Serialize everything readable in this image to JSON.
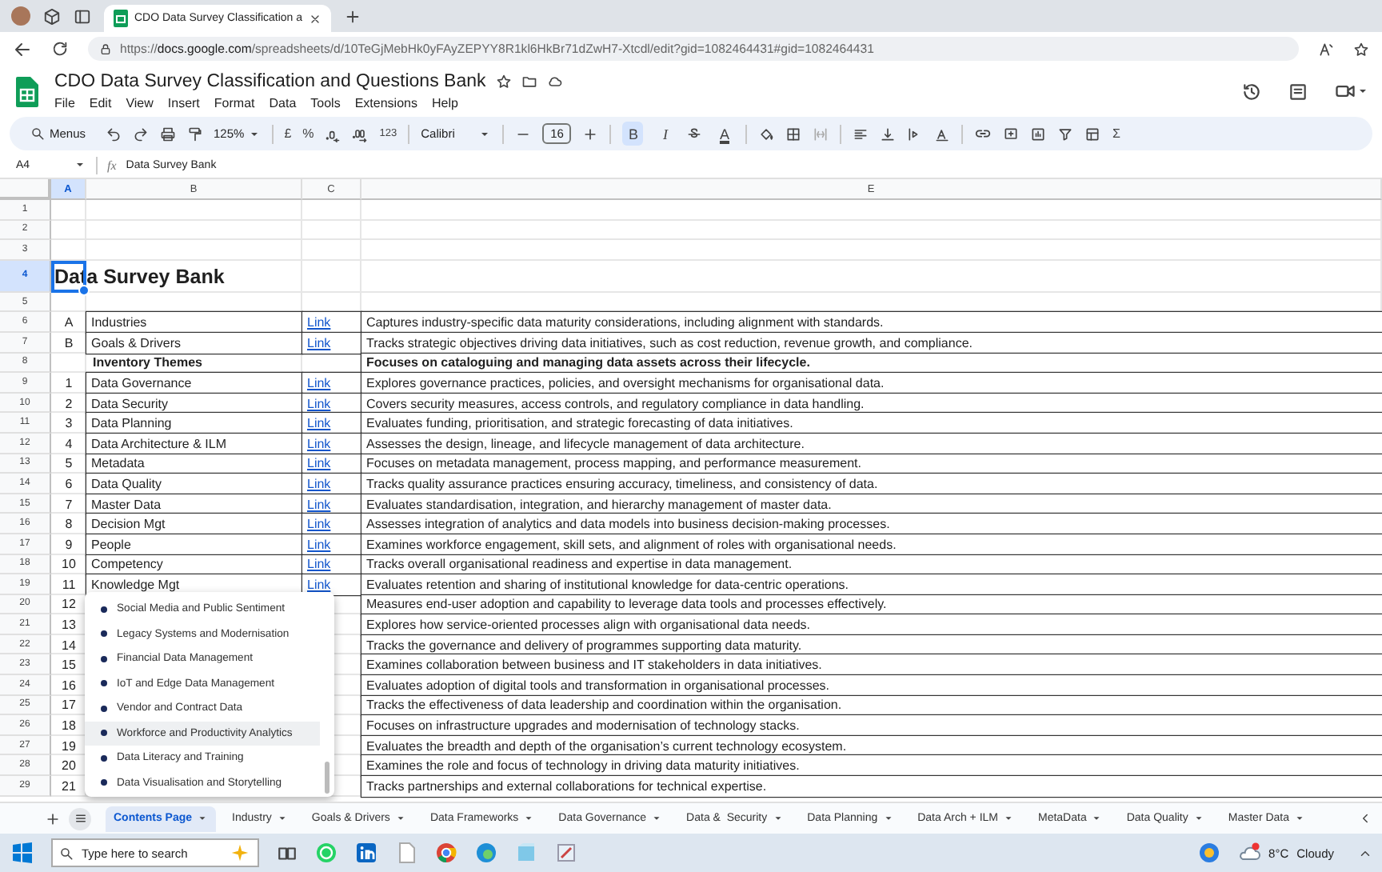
{
  "browser": {
    "tab_title": "CDO Data Survey Classification a",
    "url_scheme": "https://",
    "url_host": "docs.google.com",
    "url_path": "/spreadsheets/d/10TeGjMebHk0yFAyZEPYY8R1kl6HkBr71dZwH7-Xtcdl/edit?gid=1082464431#gid=1082464431"
  },
  "document": {
    "title": "CDO Data Survey Classification and Questions Bank",
    "menu": [
      "File",
      "Edit",
      "View",
      "Insert",
      "Format",
      "Data",
      "Tools",
      "Extensions",
      "Help"
    ]
  },
  "toolbar": {
    "search": "Menus",
    "zoom": "125%",
    "currency": "£",
    "percent": "%",
    "number_format": "123",
    "font": "Calibri",
    "font_size": "16",
    "bold": {
      "label": "B",
      "selected": true
    },
    "italic": {
      "label": "I",
      "selected": false
    },
    "text_color": "A",
    "sum": "Σ"
  },
  "formula_bar": {
    "cell": "A4",
    "function_symbol": "fx",
    "value": "Data Survey Bank"
  },
  "columns": [
    {
      "label": "A",
      "selected": true
    },
    {
      "label": "B",
      "selected": false
    },
    {
      "label": "C",
      "selected": false
    },
    {
      "label": "E",
      "selected": false
    }
  ],
  "row_numbers": [
    {
      "label": "1",
      "selected": false
    },
    {
      "label": "2",
      "selected": false
    },
    {
      "label": "3",
      "selected": false
    },
    {
      "label": "4",
      "selected": true
    },
    {
      "label": "5",
      "selected": false
    },
    {
      "label": "6",
      "selected": false
    },
    {
      "label": "7",
      "selected": false
    },
    {
      "label": "8",
      "selected": false
    },
    {
      "label": "9",
      "selected": false
    },
    {
      "label": "10",
      "selected": false
    },
    {
      "label": "11",
      "selected": false
    },
    {
      "label": "12",
      "selected": false
    },
    {
      "label": "13",
      "selected": false
    },
    {
      "label": "14",
      "selected": false
    },
    {
      "label": "15",
      "selected": false
    },
    {
      "label": "16",
      "selected": false
    },
    {
      "label": "17",
      "selected": false
    },
    {
      "label": "18",
      "selected": false
    },
    {
      "label": "19",
      "selected": false
    },
    {
      "label": "20",
      "selected": false
    },
    {
      "label": "21",
      "selected": false
    },
    {
      "label": "22",
      "selected": false
    },
    {
      "label": "23",
      "selected": false
    },
    {
      "label": "24",
      "selected": false
    },
    {
      "label": "25",
      "selected": false
    },
    {
      "label": "26",
      "selected": false
    },
    {
      "label": "27",
      "selected": false
    },
    {
      "label": "28",
      "selected": false
    },
    {
      "label": "29",
      "selected": false
    }
  ],
  "heading": "Data Survey Bank",
  "rows": [
    {
      "kind": "item",
      "number": "A",
      "name": "Industries",
      "link": "Link",
      "description": "Captures industry-specific data maturity considerations, including alignment with standards."
    },
    {
      "kind": "item",
      "number": "B",
      "name": "Goals & Drivers",
      "link": "Link",
      "description": "Tracks strategic objectives driving data initiatives, such as cost reduction, revenue growth, and compliance."
    },
    {
      "kind": "section",
      "name": "Inventory Themes",
      "description": "Focuses on cataloguing and managing data assets across their lifecycle."
    },
    {
      "kind": "item",
      "number": "1",
      "name": "Data Governance",
      "link": "Link",
      "description": "Explores governance practices, policies, and oversight mechanisms for organisational data."
    },
    {
      "kind": "item",
      "number": "2",
      "name": "Data Security",
      "link": "Link",
      "description": "Covers security measures, access controls, and regulatory compliance in data handling."
    },
    {
      "kind": "item",
      "number": "3",
      "name": "Data Planning",
      "link": "Link",
      "description": "Evaluates funding, prioritisation, and strategic forecasting of data initiatives."
    },
    {
      "kind": "item",
      "number": "4",
      "name": "Data Architecture & ILM",
      "link": "Link",
      "description": "Assesses the design, lineage, and lifecycle management of data architecture."
    },
    {
      "kind": "item",
      "number": "5",
      "name": "Metadata",
      "link": "Link",
      "description": "Focuses on metadata management, process mapping, and performance measurement."
    },
    {
      "kind": "item",
      "number": "6",
      "name": "Data Quality",
      "link": "Link",
      "description": "Tracks quality assurance practices ensuring accuracy, timeliness, and consistency of data."
    },
    {
      "kind": "item",
      "number": "7",
      "name": "Master Data",
      "link": "Link",
      "description": "Evaluates standardisation, integration, and hierarchy management of master data."
    },
    {
      "kind": "item",
      "number": "8",
      "name": "Decision Mgt",
      "link": "Link",
      "description": "Assesses integration of analytics and data models into business decision-making processes."
    },
    {
      "kind": "item",
      "number": "9",
      "name": "People",
      "link": "Link",
      "description": "Examines workforce engagement, skill sets, and alignment of roles with organisational needs."
    },
    {
      "kind": "item",
      "number": "10",
      "name": "Competency",
      "link": "Link",
      "description": "Tracks overall organisational readiness and expertise in data management."
    },
    {
      "kind": "item",
      "number": "11",
      "name": "Knowledge Mgt",
      "link": "Link",
      "description": "Evaluates retention and sharing of institutional knowledge for data-centric operations."
    },
    {
      "kind": "item",
      "number": "12",
      "description": "Measures end-user adoption and capability to leverage data tools and processes effectively."
    },
    {
      "kind": "item",
      "number": "13",
      "description": "Explores how service-oriented processes align with organisational data needs."
    },
    {
      "kind": "item",
      "number": "14",
      "description": "Tracks the governance and delivery of programmes supporting data maturity."
    },
    {
      "kind": "item",
      "number": "15",
      "description": "Examines collaboration between business and IT stakeholders in data initiatives."
    },
    {
      "kind": "item",
      "number": "16",
      "description": "Evaluates adoption of digital tools and transformation in organisational processes."
    },
    {
      "kind": "item",
      "number": "17",
      "description": "Tracks the effectiveness of data leadership and coordination within the organisation."
    },
    {
      "kind": "item",
      "number": "18",
      "description": "Focuses on infrastructure upgrades and modernisation of technology stacks."
    },
    {
      "kind": "item",
      "number": "19",
      "description": "Evaluates the breadth and depth of the organisation’s current technology ecosystem."
    },
    {
      "kind": "item",
      "number": "20",
      "description": "Examines the role and focus of technology in driving data maturity initiatives."
    },
    {
      "kind": "item",
      "number": "21",
      "description": "Tracks partnerships and external collaborations for technical expertise."
    }
  ],
  "dropdown": {
    "items": [
      {
        "label": "Social Media and Public Sentiment",
        "selected": false
      },
      {
        "label": "Legacy Systems and Modernisation",
        "selected": false
      },
      {
        "label": "Financial Data Management",
        "selected": false
      },
      {
        "label": "IoT and Edge Data Management",
        "selected": false
      },
      {
        "label": "Vendor and Contract Data",
        "selected": false
      },
      {
        "label": "Workforce and Productivity Analytics",
        "selected": true
      },
      {
        "label": "Data Literacy and Training",
        "selected": false
      },
      {
        "label": "Data Visualisation and Storytelling",
        "selected": false
      }
    ]
  },
  "sheet_tabs": [
    {
      "label": "Contents Page",
      "selected": true
    },
    {
      "label": "Industry",
      "selected": false
    },
    {
      "label": "Goals & Drivers",
      "selected": false
    },
    {
      "label": "Data Frameworks",
      "selected": false
    },
    {
      "label": "Data Governance",
      "selected": false
    },
    {
      "label": "Data &  Security",
      "selected": false
    },
    {
      "label": "Data Planning",
      "selected": false
    },
    {
      "label": "Data Arch + ILM",
      "selected": false
    },
    {
      "label": "MetaData",
      "selected": false
    },
    {
      "label": "Data Quality",
      "selected": false
    },
    {
      "label": "Master Data",
      "selected": false
    }
  ],
  "taskbar": {
    "search_placeholder": "Type here to search",
    "temperature": "8°C",
    "weather": "Cloudy"
  }
}
